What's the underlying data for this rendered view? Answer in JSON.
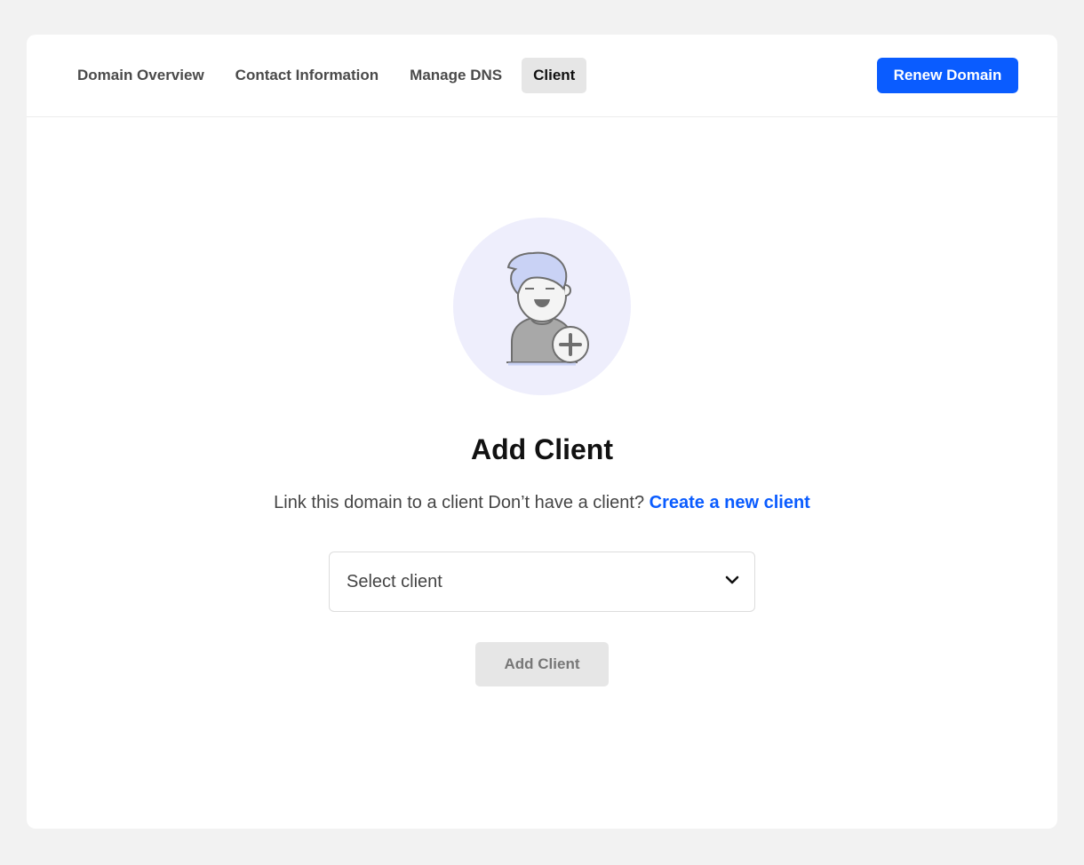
{
  "tabs": [
    {
      "label": "Domain Overview",
      "active": false
    },
    {
      "label": "Contact Information",
      "active": false
    },
    {
      "label": "Manage DNS",
      "active": false
    },
    {
      "label": "Client",
      "active": true
    }
  ],
  "renew_label": "Renew Domain",
  "empty_state": {
    "illustration": "user-plus-icon",
    "title": "Add Client",
    "description": "Link this domain to a client Don’t have a client?",
    "create_link": "Create a new client"
  },
  "client_select": {
    "placeholder": "Select client",
    "icon": "chevron-down-icon"
  },
  "add_button_label": "Add Client",
  "add_button_disabled": true,
  "colors": {
    "accent": "#0a5cff",
    "illustration_bg": "#eeeefc",
    "page_bg": "#f2f2f2"
  }
}
